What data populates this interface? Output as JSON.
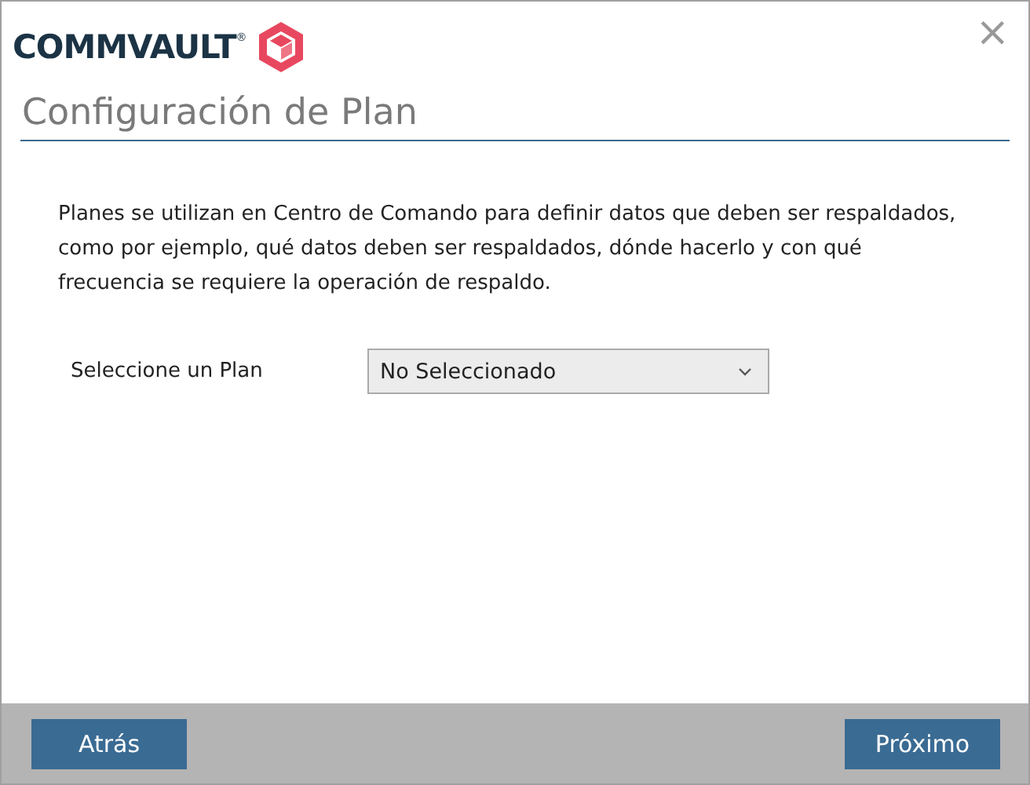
{
  "logo": {
    "text": "COMMVAULT$^{®}$"
  },
  "close": {
    "symbol": "×"
  },
  "title": "Configuración de Plan",
  "description": "Planes se utilizan en Centro de Comando para definir datos que deben ser respaldados, como por ejemplo, qué datos deben ser respaldados, dónde hacerlo y con qué frecuencia se requiere la operación de respaldo.",
  "plan_field": {
    "label": "Seleccione un Plan",
    "value": "No Seleccionado"
  },
  "buttons": [
    {
      "label": "Atrás"
    },
    {
      "label": "Próximo"
    }
  ]
}
